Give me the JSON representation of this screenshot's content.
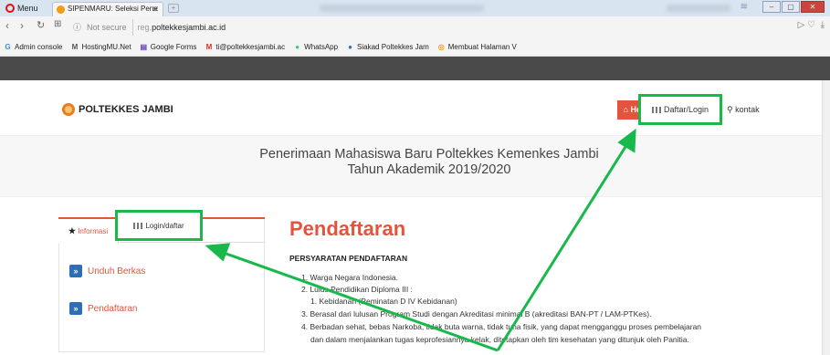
{
  "browser": {
    "menu_label": "Menu",
    "tab_title": "SIPENMARU: Seleksi Pene",
    "tab_close": "✕",
    "address": {
      "secure_label": "Not secure",
      "url_prefix": "reg.",
      "url_host": "poltekkesjambi.ac.id"
    },
    "bookmarks": [
      {
        "label": "Admin console",
        "icon": "google-g-icon",
        "glyph": "G",
        "color": "#4285f4"
      },
      {
        "label": "HostingMU.Net",
        "icon": "hostingmu-icon",
        "glyph": "M",
        "color": "#555555"
      },
      {
        "label": "Google Forms",
        "icon": "google-forms-icon",
        "glyph": "▤",
        "color": "#673ab7"
      },
      {
        "label": "ti@poltekkesjambi.ac",
        "icon": "gmail-icon",
        "glyph": "M",
        "color": "#d93025"
      },
      {
        "label": "WhatsApp",
        "icon": "whatsapp-icon",
        "glyph": "●",
        "color": "#25d366"
      },
      {
        "label": "Siakad Poltekkes Jam",
        "icon": "siakad-icon",
        "glyph": "●",
        "color": "#2c6fb7"
      },
      {
        "label": "Membuat Halaman V",
        "icon": "page-icon",
        "glyph": "◎",
        "color": "#f39c12"
      }
    ]
  },
  "header": {
    "logo_text": "POLTEKKES JAMBI",
    "nav": {
      "home": "Home",
      "login": "Daftar/Login",
      "kontak": "kontak"
    }
  },
  "banner": {
    "line1": "Penerimaan Mahasiswa Baru Poltekkes Kemenkes Jambi",
    "line2": "Tahun Akademik 2019/2020"
  },
  "sidebar": {
    "tabs": {
      "informasi": "Informasi",
      "login": "Login/daftar"
    },
    "items": [
      "Unduh Berkas",
      "Pendaftaran"
    ]
  },
  "content": {
    "title": "Pendaftaran",
    "subtitle": "PERSYARATAN PENDAFTARAN",
    "requirements": [
      "1. Warga Negara Indonesia.",
      "2. Lulus Pendidikan Diploma III :",
      "1. Kebidanan  (Peminatan D IV Kebidanan)",
      "3. Berasal dari lulusan Program Studi dengan Akreditasi minimal B (akreditasi BAN-PT / LAM-PTKes).",
      "4. Berbadan sehat, bebas Narkoba, tidak buta warna, tidak tuna fisik, yang dapat mengganggu proses pembelajaran",
      "dan dalam menjalankan tugas keprofesiannya kelak, ditetapkan oleh tim kesehatan yang ditunjuk oleh Panitia."
    ]
  },
  "colors": {
    "accent": "#e4543c",
    "highlight": "#18b94a",
    "chevron": "#2c6fb7"
  }
}
